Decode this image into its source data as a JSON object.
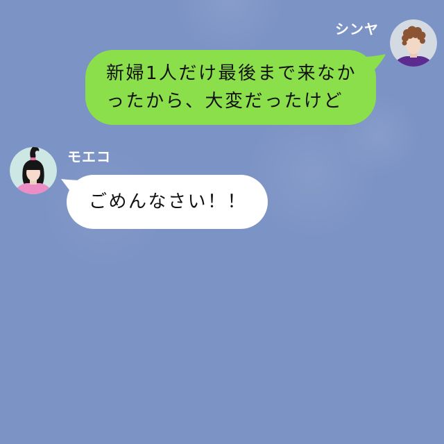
{
  "chat": {
    "messages": [
      {
        "sender": "シンヤ",
        "avatar_icon": "curly-hair-man-avatar-icon",
        "bubble_color": "#8bdf4b",
        "lines": [
          "新婦1人だけ最後まで来なか",
          "ったから、大変だったけど"
        ]
      },
      {
        "sender": "モエコ",
        "avatar_icon": "ponytail-woman-avatar-icon",
        "bubble_color": "#ffffff",
        "lines": [
          "ごめんなさい！！"
        ]
      }
    ]
  },
  "colors": {
    "background": "#7c93c5",
    "name_text": "#ffffff",
    "message_text": "#111111"
  }
}
